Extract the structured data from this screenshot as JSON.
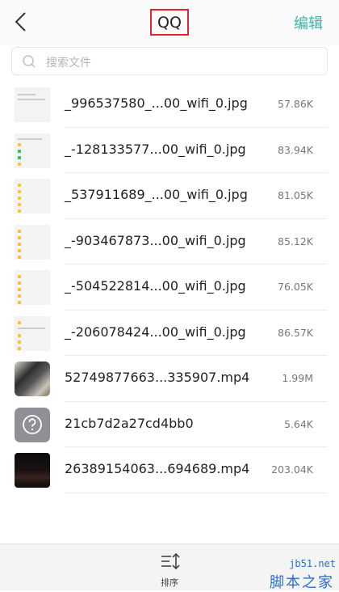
{
  "header": {
    "title": "QQ",
    "edit_label": "编辑"
  },
  "search": {
    "placeholder": "搜索文件"
  },
  "files": [
    {
      "name": "_996537580_...00_wifi_0.jpg",
      "size": "57.86K",
      "thumb": "doc"
    },
    {
      "name": "_-128133577...00_wifi_0.jpg",
      "size": "83.94K",
      "thumb": "doc"
    },
    {
      "name": "_537911689_...00_wifi_0.jpg",
      "size": "81.05K",
      "thumb": "doc"
    },
    {
      "name": "_-903467873...00_wifi_0.jpg",
      "size": "85.12K",
      "thumb": "doc"
    },
    {
      "name": "_-504522814...00_wifi_0.jpg",
      "size": "76.05K",
      "thumb": "doc"
    },
    {
      "name": "_-206078424...00_wifi_0.jpg",
      "size": "86.57K",
      "thumb": "doc"
    },
    {
      "name": "52749877663...335907.mp4",
      "size": "1.99M",
      "thumb": "photo-a"
    },
    {
      "name": "21cb7d2a27cd4bb0",
      "size": "5.64K",
      "thumb": "unknown"
    },
    {
      "name": "26389154063...694689.mp4",
      "size": "203.04K",
      "thumb": "photo-b"
    }
  ],
  "bottom": {
    "sort_label": "排序"
  },
  "watermark": {
    "site": "jb51.net",
    "brand": "脚本之家"
  },
  "colors": {
    "accent": "#3bb5a7",
    "highlight_box": "#e0242c"
  }
}
